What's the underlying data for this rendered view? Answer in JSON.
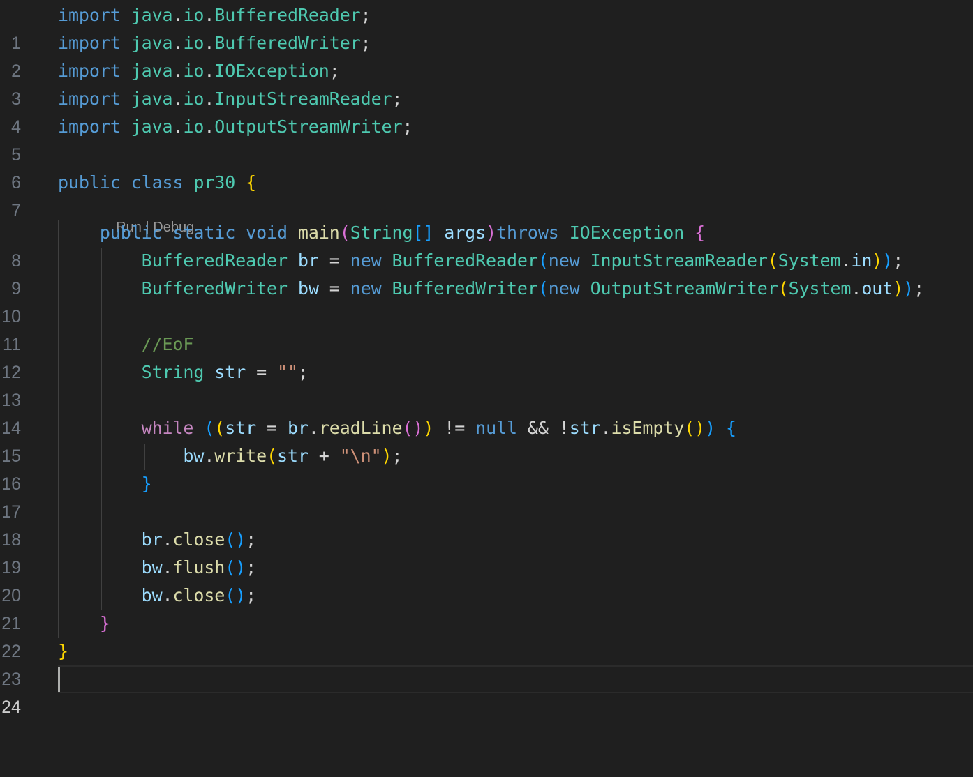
{
  "editor": {
    "language": "java",
    "codelens": {
      "run_label": "Run",
      "separator": " | ",
      "debug_label": "Debug"
    },
    "line_numbers": [
      "1",
      "2",
      "3",
      "4",
      "5",
      "6",
      "7",
      "8",
      "9",
      "10",
      "11",
      "12",
      "13",
      "14",
      "15",
      "16",
      "17",
      "18",
      "19",
      "20",
      "21",
      "22",
      "23",
      "24"
    ],
    "current_line": 24,
    "lines": [
      "import java.io.BufferedReader;",
      "import java.io.BufferedWriter;",
      "import java.io.IOException;",
      "import java.io.InputStreamReader;",
      "import java.io.OutputStreamWriter;",
      "",
      "public class pr30 {",
      "    public static void main(String[] args)throws IOException {",
      "        BufferedReader br = new BufferedReader(new InputStreamReader(System.in));",
      "        BufferedWriter bw = new BufferedWriter(new OutputStreamWriter(System.out));",
      "",
      "        //EoF",
      "        String str = \"\";",
      "",
      "        while ((str = br.readLine()) != null && !str.isEmpty()) {",
      "            bw.write(str + \"\\n\");",
      "        }",
      "",
      "        br.close();",
      "        bw.flush();",
      "        bw.close();",
      "    }",
      "}",
      ""
    ],
    "colors": {
      "background": "#1f1f1f",
      "keyword": "#569cd6",
      "control": "#c586c0",
      "type": "#4ec9b0",
      "variable": "#9cdcfe",
      "function": "#dcdcaa",
      "string": "#ce9178",
      "comment": "#6a9955",
      "bracket_1": "#ffd700",
      "bracket_2": "#da70d6",
      "bracket_3": "#179fff",
      "line_number": "#6e7681",
      "codelens": "#999999"
    }
  }
}
